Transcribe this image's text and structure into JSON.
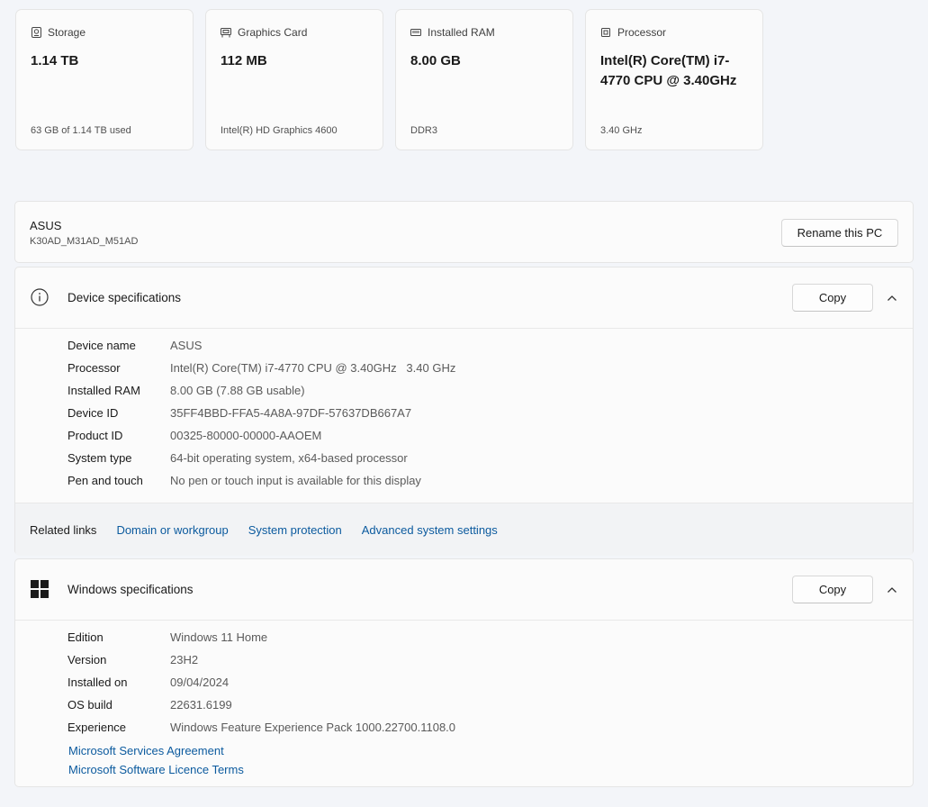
{
  "cards": [
    {
      "label": "Storage",
      "icon": "storage-icon",
      "value": "1.14 TB",
      "sub": "63 GB of 1.14 TB used"
    },
    {
      "label": "Graphics Card",
      "icon": "graphics-card-icon",
      "value": "112 MB",
      "sub": "Intel(R) HD Graphics 4600"
    },
    {
      "label": "Installed RAM",
      "icon": "ram-icon",
      "value": "8.00 GB",
      "sub": "DDR3"
    },
    {
      "label": "Processor",
      "icon": "processor-icon",
      "value": "Intel(R) Core(TM) i7-4770 CPU @ 3.40GHz",
      "sub": "3.40 GHz"
    }
  ],
  "pc": {
    "name": "ASUS",
    "model": "K30AD_M31AD_M51AD",
    "rename_label": "Rename this PC"
  },
  "device_specs": {
    "title": "Device specifications",
    "icon": "info-icon",
    "copy_label": "Copy",
    "rows": [
      {
        "label": "Device name",
        "value": "ASUS"
      },
      {
        "label": "Processor",
        "value": "Intel(R) Core(TM) i7-4770 CPU @ 3.40GHz   3.40 GHz"
      },
      {
        "label": "Installed RAM",
        "value": "8.00 GB (7.88 GB usable)"
      },
      {
        "label": "Device ID",
        "value": "35FF4BBD-FFA5-4A8A-97DF-57637DB667A7"
      },
      {
        "label": "Product ID",
        "value": "00325-80000-00000-AAOEM"
      },
      {
        "label": "System type",
        "value": "64-bit operating system, x64-based processor"
      },
      {
        "label": "Pen and touch",
        "value": "No pen or touch input is available for this display"
      }
    ],
    "related_title": "Related links",
    "related_links": [
      "Domain or workgroup",
      "System protection",
      "Advanced system settings"
    ]
  },
  "windows_specs": {
    "title": "Windows specifications",
    "icon": "windows-logo-icon",
    "copy_label": "Copy",
    "rows": [
      {
        "label": "Edition",
        "value": "Windows 11 Home"
      },
      {
        "label": "Version",
        "value": "23H2"
      },
      {
        "label": "Installed on",
        "value": "09/04/2024"
      },
      {
        "label": "OS build",
        "value": "22631.6199"
      },
      {
        "label": "Experience",
        "value": "Windows Feature Experience Pack 1000.22700.1108.0"
      }
    ],
    "links": [
      "Microsoft Services Agreement",
      "Microsoft Software Licence Terms"
    ]
  },
  "colors": {
    "link": "#0b5a9e",
    "background": "#f3f5f9",
    "card": "#fbfbfb"
  }
}
